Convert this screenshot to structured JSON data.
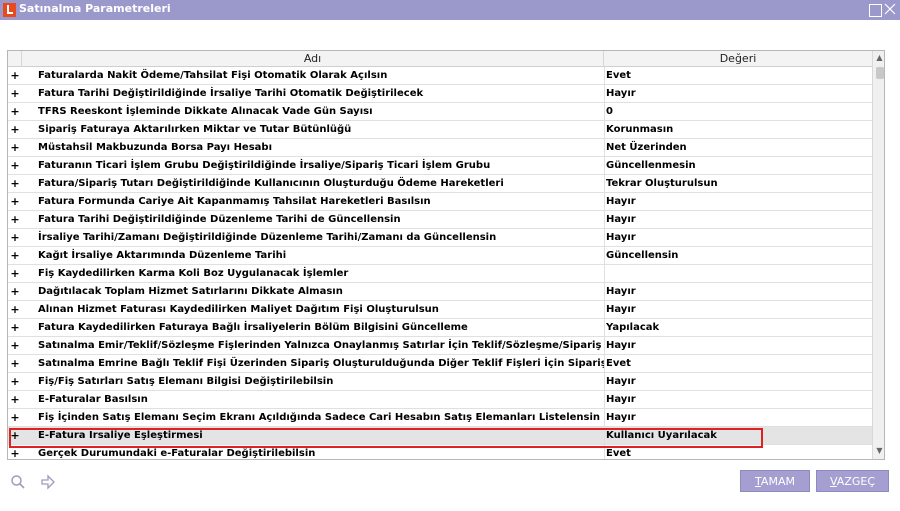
{
  "window": {
    "title": "Satınalma Parametreleri"
  },
  "grid": {
    "columns": {
      "expand": "",
      "name": "Adı",
      "value": "Değeri"
    },
    "rows": [
      {
        "expand": "+",
        "name": "Faturalarda Nakit Ödeme/Tahsilat Fişi Otomatik Olarak Açılsın",
        "value": "Evet"
      },
      {
        "expand": "+",
        "name": "Fatura Tarihi Değiştirildiğinde İrsaliye Tarihi Otomatik Değiştirilecek",
        "value": "Hayır"
      },
      {
        "expand": "+",
        "name": "TFRS Reeskont İşleminde Dikkate Alınacak Vade Gün Sayısı",
        "value": "0"
      },
      {
        "expand": "+",
        "name": "Sipariş Faturaya Aktarılırken Miktar ve Tutar Bütünlüğü",
        "value": "Korunmasın"
      },
      {
        "expand": "+",
        "name": "Müstahsil Makbuzunda Borsa Payı Hesabı",
        "value": "Net Üzerinden"
      },
      {
        "expand": "+",
        "name": "Faturanın Ticari İşlem Grubu Değiştirildiğinde İrsaliye/Sipariş Ticari İşlem Grubu",
        "value": "Güncellenmesin"
      },
      {
        "expand": "+",
        "name": "Fatura/Sipariş Tutarı Değiştirildiğinde Kullanıcının Oluşturduğu Ödeme Hareketleri",
        "value": "Tekrar Oluşturulsun"
      },
      {
        "expand": "+",
        "name": "Fatura Formunda Cariye Ait Kapanmamış Tahsilat Hareketleri Basılsın",
        "value": "Hayır"
      },
      {
        "expand": "+",
        "name": "Fatura Tarihi Değiştirildiğinde Düzenleme Tarihi de Güncellensin",
        "value": "Hayır"
      },
      {
        "expand": "+",
        "name": "İrsaliye Tarihi/Zamanı Değiştirildiğinde Düzenleme Tarihi/Zamanı da Güncellensin",
        "value": "Hayır"
      },
      {
        "expand": "+",
        "name": "Kağıt İrsaliye Aktarımında Düzenleme Tarihi",
        "value": "Güncellensin"
      },
      {
        "expand": "+",
        "name": "Fiş Kaydedilirken Karma Koli Boz Uygulanacak İşlemler",
        "value": ""
      },
      {
        "expand": "+",
        "name": "Dağıtılacak Toplam Hizmet Satırlarını Dikkate Almasın",
        "value": "Hayır"
      },
      {
        "expand": "+",
        "name": "Alınan Hizmet Faturası Kaydedilirken Maliyet Dağıtım Fişi Oluşturulsun",
        "value": "Hayır"
      },
      {
        "expand": "+",
        "name": "Fatura Kaydedilirken Faturaya Bağlı İrsaliyelerin Bölüm Bilgisini Güncelleme",
        "value": "Yapılacak"
      },
      {
        "expand": "+",
        "name": "Satınalma Emir/Teklif/Sözleşme Fişlerinden Yalnızca Onaylanmış Satırlar İçin Teklif/Sözleşme/Sipariş Eklenebil",
        "value": "Hayır"
      },
      {
        "expand": "+",
        "name": "Satınalma Emrine Bağlı Teklif Fişi Üzerinden Sipariş Oluşturulduğunda Diğer Teklif Fişleri İçin Sipariş Oluşturulab",
        "value": "Evet"
      },
      {
        "expand": "+",
        "name": "Fiş/Fiş Satırları Satış Elemanı Bilgisi Değiştirilebilsin",
        "value": "Hayır"
      },
      {
        "expand": "+",
        "name": "E-Faturalar Basılsın",
        "value": "Hayır"
      },
      {
        "expand": "+",
        "name": "Fiş İçinden Satış Elemanı Seçim Ekranı Açıldığında Sadece Cari Hesabın Satış Elemanları Listelensin",
        "value": "Hayır"
      },
      {
        "expand": "+",
        "name": "E-Fatura İrsaliye Eşleştirmesi",
        "value": "Kullanıcı Uyarılacak"
      },
      {
        "expand": "+",
        "name": "Gerçek Durumundaki e-Faturalar Değiştirilebilsin",
        "value": "Evet"
      }
    ]
  },
  "footer": {
    "ok_label": "TAMAM",
    "ok_accel": "T",
    "ok_rest": "AMAM",
    "cancel_label": "VAZGEÇ",
    "cancel_accel": "V",
    "cancel_rest": "AZGEÇ"
  },
  "colors": {
    "titlebar": "#9b98cc",
    "button": "#a49ed1",
    "highlight": "#dd2222"
  },
  "icons": [
    "app-logo-icon",
    "restore-icon",
    "close-icon",
    "search-icon",
    "arrow-right-icon"
  ]
}
